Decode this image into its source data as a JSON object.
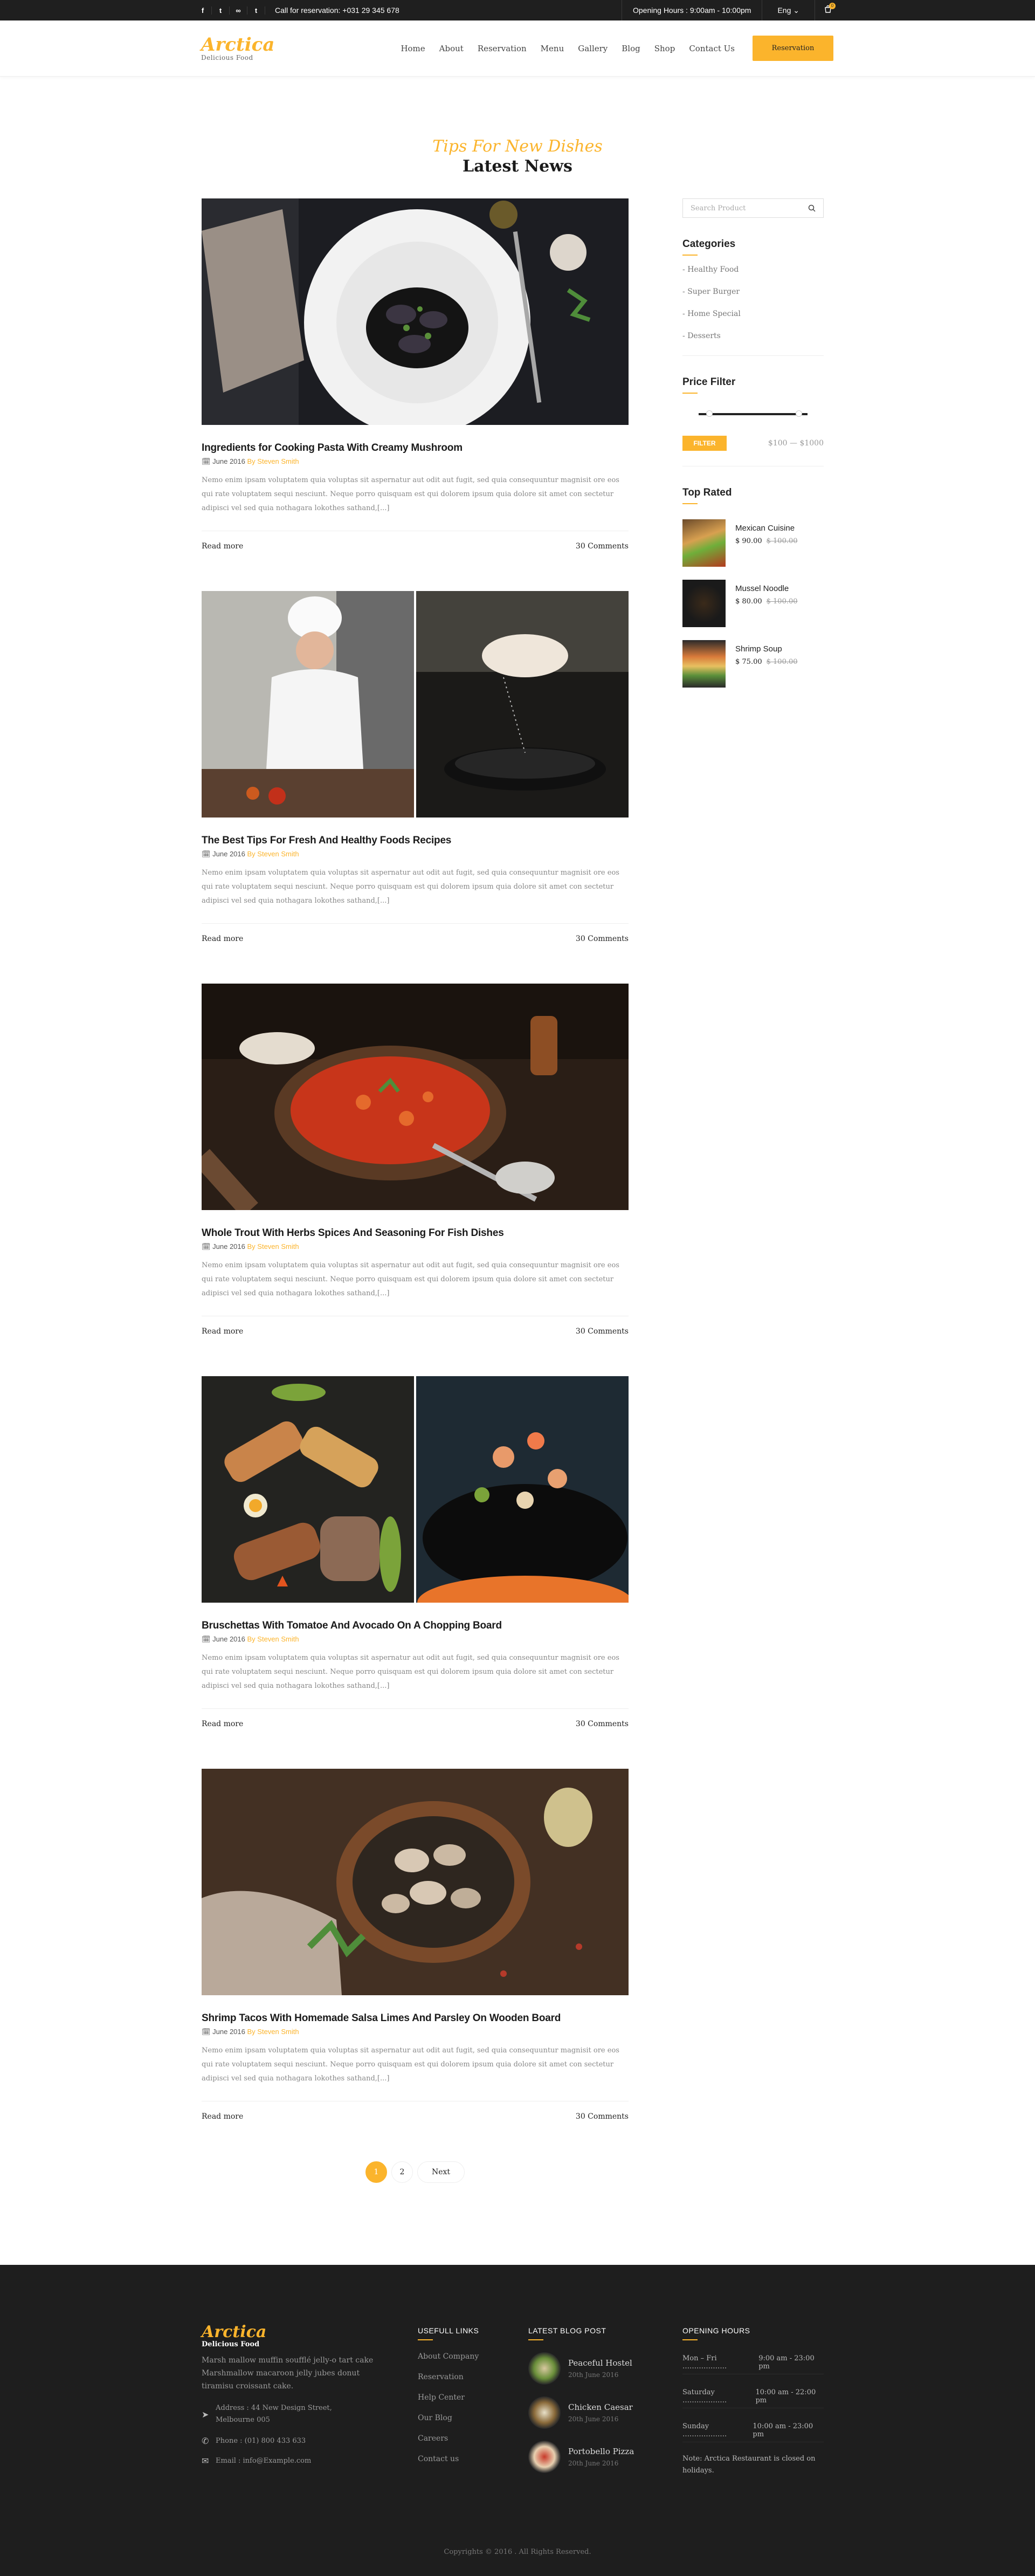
{
  "topbar": {
    "social": [
      "f",
      "t",
      "∞",
      "t"
    ],
    "call": "Call for reservation: +031 29 345 678",
    "hours": "Opening Hours : 9:00am - 10:00pm",
    "language": "Eng ⌄",
    "cart_count": "0"
  },
  "header": {
    "logo_name": "Arctica",
    "logo_tagline": "Delicious Food",
    "nav": [
      "Home",
      "About",
      "Reservation",
      "Menu",
      "Gallery",
      "Blog",
      "Shop",
      "Contact Us"
    ],
    "reservation_button": "Reservation"
  },
  "section": {
    "script_title": "Tips For New Dishes",
    "title": "Latest News"
  },
  "posts": [
    {
      "title": "Ingredients for Cooking Pasta With Creamy Mushroom",
      "date": "June 2016",
      "by": "By Steven Smith",
      "excerpt": "Nemo enim ipsam voluptatem quia voluptas sit aspernatur aut odit aut fugit, sed quia consequuntur magnisit ore eos qui rate voluptatem sequi nesciunt. Neque porro quisquam est qui dolorem ipsum quia dolore sit amet con sectetur adipisci vel sed quia nothagara lokothes sathand,[...]",
      "read_more": "Read more",
      "comments": "30 Comments"
    },
    {
      "title": "The Best Tips For Fresh And Healthy Foods Recipes",
      "date": "June 2016",
      "by": "By Steven Smith",
      "excerpt": "Nemo enim ipsam voluptatem quia voluptas sit aspernatur aut odit aut fugit, sed quia consequuntur magnisit ore eos qui rate voluptatem sequi nesciunt. Neque porro quisquam est qui dolorem ipsum quia dolore sit amet con sectetur adipisci vel sed quia nothagara lokothes sathand,[...]",
      "read_more": "Read more",
      "comments": "30 Comments"
    },
    {
      "title": "Whole Trout With Herbs Spices And Seasoning For Fish Dishes",
      "date": "June 2016",
      "by": "By Steven Smith",
      "excerpt": "Nemo enim ipsam voluptatem quia voluptas sit aspernatur aut odit aut fugit, sed quia consequuntur magnisit ore eos qui rate voluptatem sequi nesciunt. Neque porro quisquam est qui dolorem ipsum quia dolore sit amet con sectetur adipisci vel sed quia nothagara lokothes sathand,[...]",
      "read_more": "Read more",
      "comments": "30 Comments"
    },
    {
      "title": "Bruschettas With Tomatoe And Avocado On A Chopping Board",
      "date": "June 2016",
      "by": "By Steven Smith",
      "excerpt": "Nemo enim ipsam voluptatem quia voluptas sit aspernatur aut odit aut fugit, sed quia consequuntur magnisit ore eos qui rate voluptatem sequi nesciunt. Neque porro quisquam est qui dolorem ipsum quia dolore sit amet con sectetur adipisci vel sed quia nothagara lokothes sathand,[...]",
      "read_more": "Read more",
      "comments": "30 Comments"
    },
    {
      "title": "Shrimp Tacos With Homemade Salsa Limes And Parsley On Wooden Board",
      "date": "June 2016",
      "by": "By Steven Smith",
      "excerpt": "Nemo enim ipsam voluptatem quia voluptas sit aspernatur aut odit aut fugit, sed quia consequuntur magnisit ore eos qui rate voluptatem sequi nesciunt. Neque porro quisquam est qui dolorem ipsum quia dolore sit amet con sectetur adipisci vel sed quia nothagara lokothes sathand,[...]",
      "read_more": "Read more",
      "comments": "30 Comments"
    }
  ],
  "sidebar": {
    "search_placeholder": "Search Product",
    "categories_title": "Categories",
    "categories": [
      "Healthy Food",
      "Super Burger",
      "Home Special",
      "Desserts"
    ],
    "price_filter_title": "Price Filter",
    "filter_button": "FILTER",
    "price_range": "$100 — $1000",
    "top_rated_title": "Top Rated",
    "top_rated": [
      {
        "name": "Mexican Cuisine",
        "price": "$ 90.00",
        "old": "$ 100.00"
      },
      {
        "name": "Mussel Noodle",
        "price": "$ 80.00",
        "old": "$ 100.00"
      },
      {
        "name": "Shrimp Soup",
        "price": "$ 75.00",
        "old": "$ 100.00"
      }
    ]
  },
  "pagination": {
    "pages": [
      "1",
      "2"
    ],
    "next": "Next"
  },
  "footer": {
    "logo_name": "Arctica",
    "logo_tagline": "Delicious Food",
    "about": "Marsh mallow muffin soufflé jelly-o tart cake Marshmallow macaroon jelly jubes donut tiramisu croissant cake.",
    "address": "Address : 44 New Design Street, Melbourne 005",
    "phone": "Phone : (01) 800 433 633",
    "email": "Email : info@Example.com",
    "links_title": "USEFULL LINKS",
    "links": [
      "About Company",
      "Reservation",
      "Help Center",
      "Our Blog",
      "Careers",
      "Contact us"
    ],
    "blog_title": "LATEST BLOG POST",
    "blog": [
      {
        "title": "Peaceful Hostel",
        "date": "20th June 2016"
      },
      {
        "title": "Chicken Caesar",
        "date": "20th June 2016"
      },
      {
        "title": "Portobello Pizza",
        "date": "20th June 2016"
      }
    ],
    "hours_title": "OPENING HOURS",
    "hours": [
      {
        "day": "Mon – Fri ……………….",
        "time": "9:00 am - 23:00 pm"
      },
      {
        "day": "Saturday ……………….",
        "time": "10:00 am - 22:00 pm"
      },
      {
        "day": "Sunday ……………….",
        "time": "10:00 am - 23:00 pm"
      }
    ],
    "note": "Note: Arctica Restaurant is closed on holidays.",
    "copyright": "Copyrights © 2016 . All Rights Reserved."
  }
}
